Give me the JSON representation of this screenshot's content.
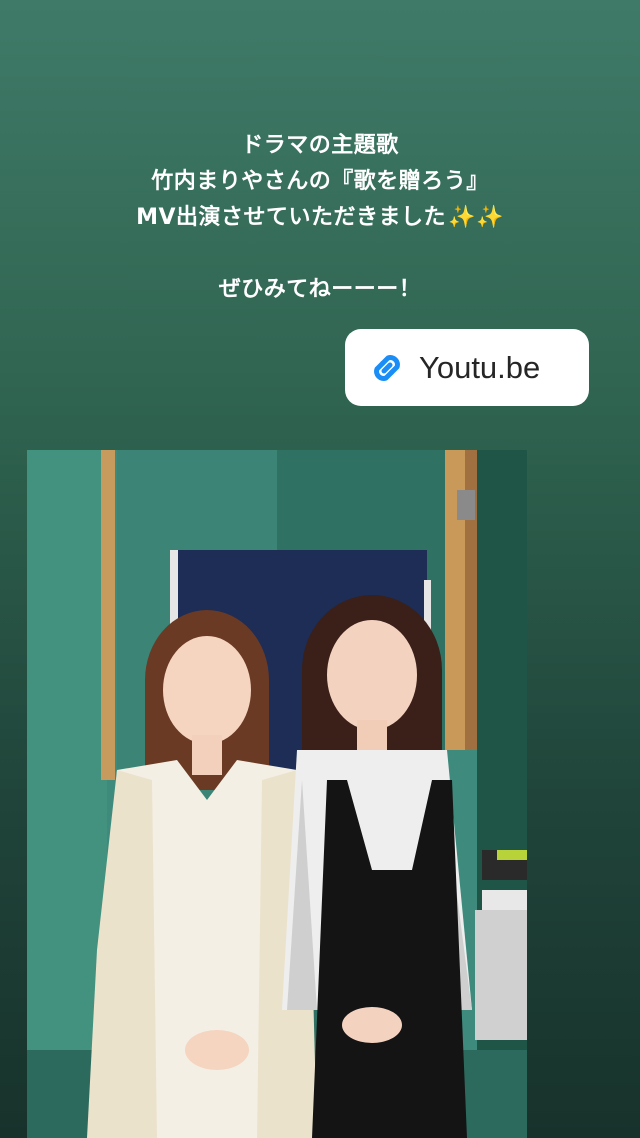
{
  "caption": {
    "lines": [
      "ドラマの主題歌",
      "竹内まりやさんの『歌を贈ろう』",
      "MV出演させていただきました",
      "ぜひみてねーーー！"
    ],
    "sparkles": "✨✨"
  },
  "link_sticker": {
    "label": "Youtu.be",
    "icon": "link-icon",
    "accent_color": "#1a8ef6"
  },
  "photo": {
    "icon": "studio-photo"
  }
}
